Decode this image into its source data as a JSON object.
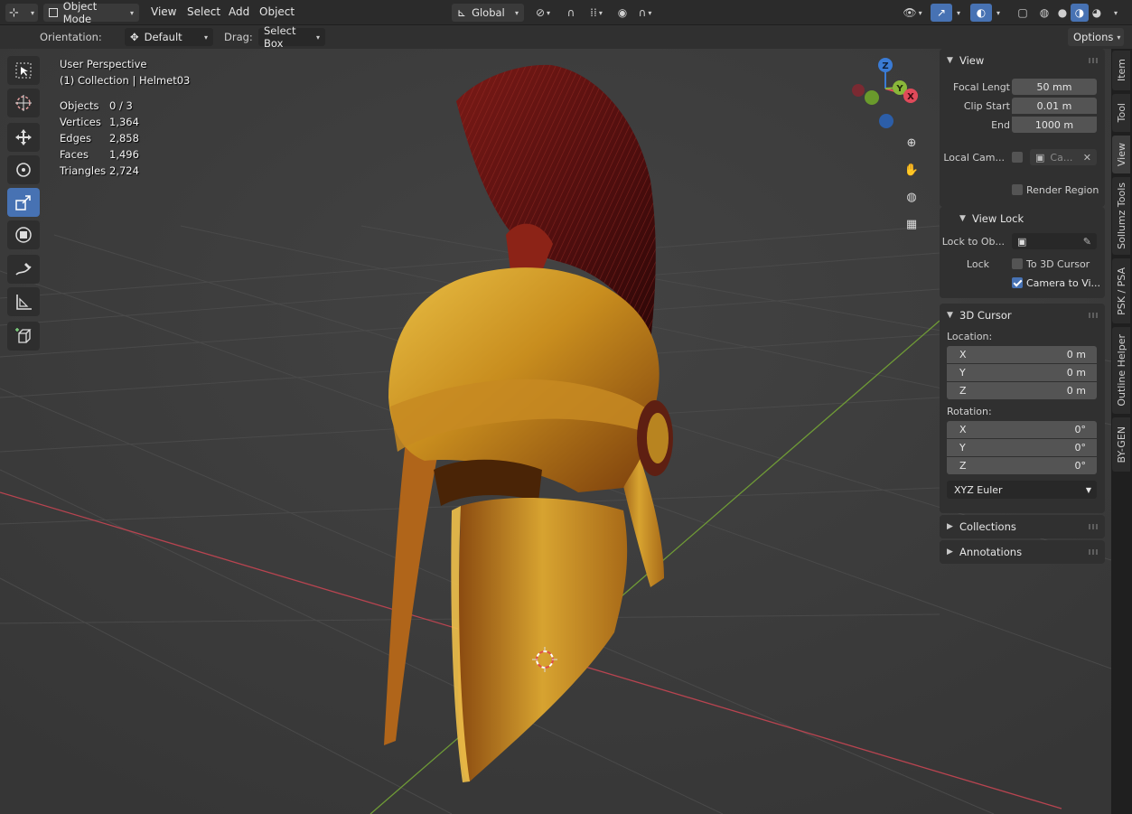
{
  "header": {
    "mode": "Object Mode",
    "menu": [
      "View",
      "Select",
      "Add",
      "Object"
    ],
    "transform_orientation": "Global",
    "options_label": "Options"
  },
  "tool_settings": {
    "orientation_label": "Orientation:",
    "orientation_value": "Default",
    "drag_label": "Drag:",
    "drag_value": "Select Box"
  },
  "viewport": {
    "perspective": "User Perspective",
    "collection": "(1) Collection | Helmet03",
    "stats": [
      {
        "label": "Objects",
        "value": "0 / 3"
      },
      {
        "label": "Vertices",
        "value": "1,364"
      },
      {
        "label": "Edges",
        "value": "2,858"
      },
      {
        "label": "Faces",
        "value": "1,496"
      },
      {
        "label": "Triangles",
        "value": "2,724"
      }
    ],
    "gizmo_axes": {
      "x": "X",
      "y": "Y",
      "z": "Z"
    }
  },
  "toolbar": [
    "select-box-tool",
    "cursor-tool",
    "move-tool",
    "rotate-tool",
    "scale-tool",
    "transform-tool",
    "annotate-tool",
    "measure-tool",
    "add-cube-tool"
  ],
  "sidebar": {
    "view_panel": {
      "title": "View",
      "focal_length_label": "Focal Lengt",
      "focal_length_value": "50 mm",
      "clip_start_label": "Clip Start",
      "clip_start_value": "0.01 m",
      "end_label": "End",
      "end_value": "1000 m",
      "local_camera_label": "Local Cam...",
      "local_camera_value": "Ca...",
      "render_region_label": "Render Region",
      "view_lock_title": "View Lock",
      "lock_to_object_label": "Lock to Ob...",
      "lock_label": "Lock",
      "to_3d_cursor_label": "To 3D Cursor",
      "camera_to_view_label": "Camera to Vi..."
    },
    "cursor_panel": {
      "title": "3D Cursor",
      "location_label": "Location:",
      "location": [
        {
          "axis": "X",
          "value": "0 m"
        },
        {
          "axis": "Y",
          "value": "0 m"
        },
        {
          "axis": "Z",
          "value": "0 m"
        }
      ],
      "rotation_label": "Rotation:",
      "rotation": [
        {
          "axis": "X",
          "value": "0°"
        },
        {
          "axis": "Y",
          "value": "0°"
        },
        {
          "axis": "Z",
          "value": "0°"
        }
      ],
      "rotation_mode": "XYZ Euler"
    },
    "collections_title": "Collections",
    "annotations_title": "Annotations"
  },
  "tabs": [
    "Item",
    "Tool",
    "View",
    "Sollumz Tools",
    "PSK / PSA",
    "Outline Helper",
    "BY-GEN"
  ],
  "colors": {
    "accent": "#4772b3",
    "x_axis": "#e04a5a",
    "y_axis": "#8ab73a",
    "z_axis": "#3a7bd5"
  }
}
